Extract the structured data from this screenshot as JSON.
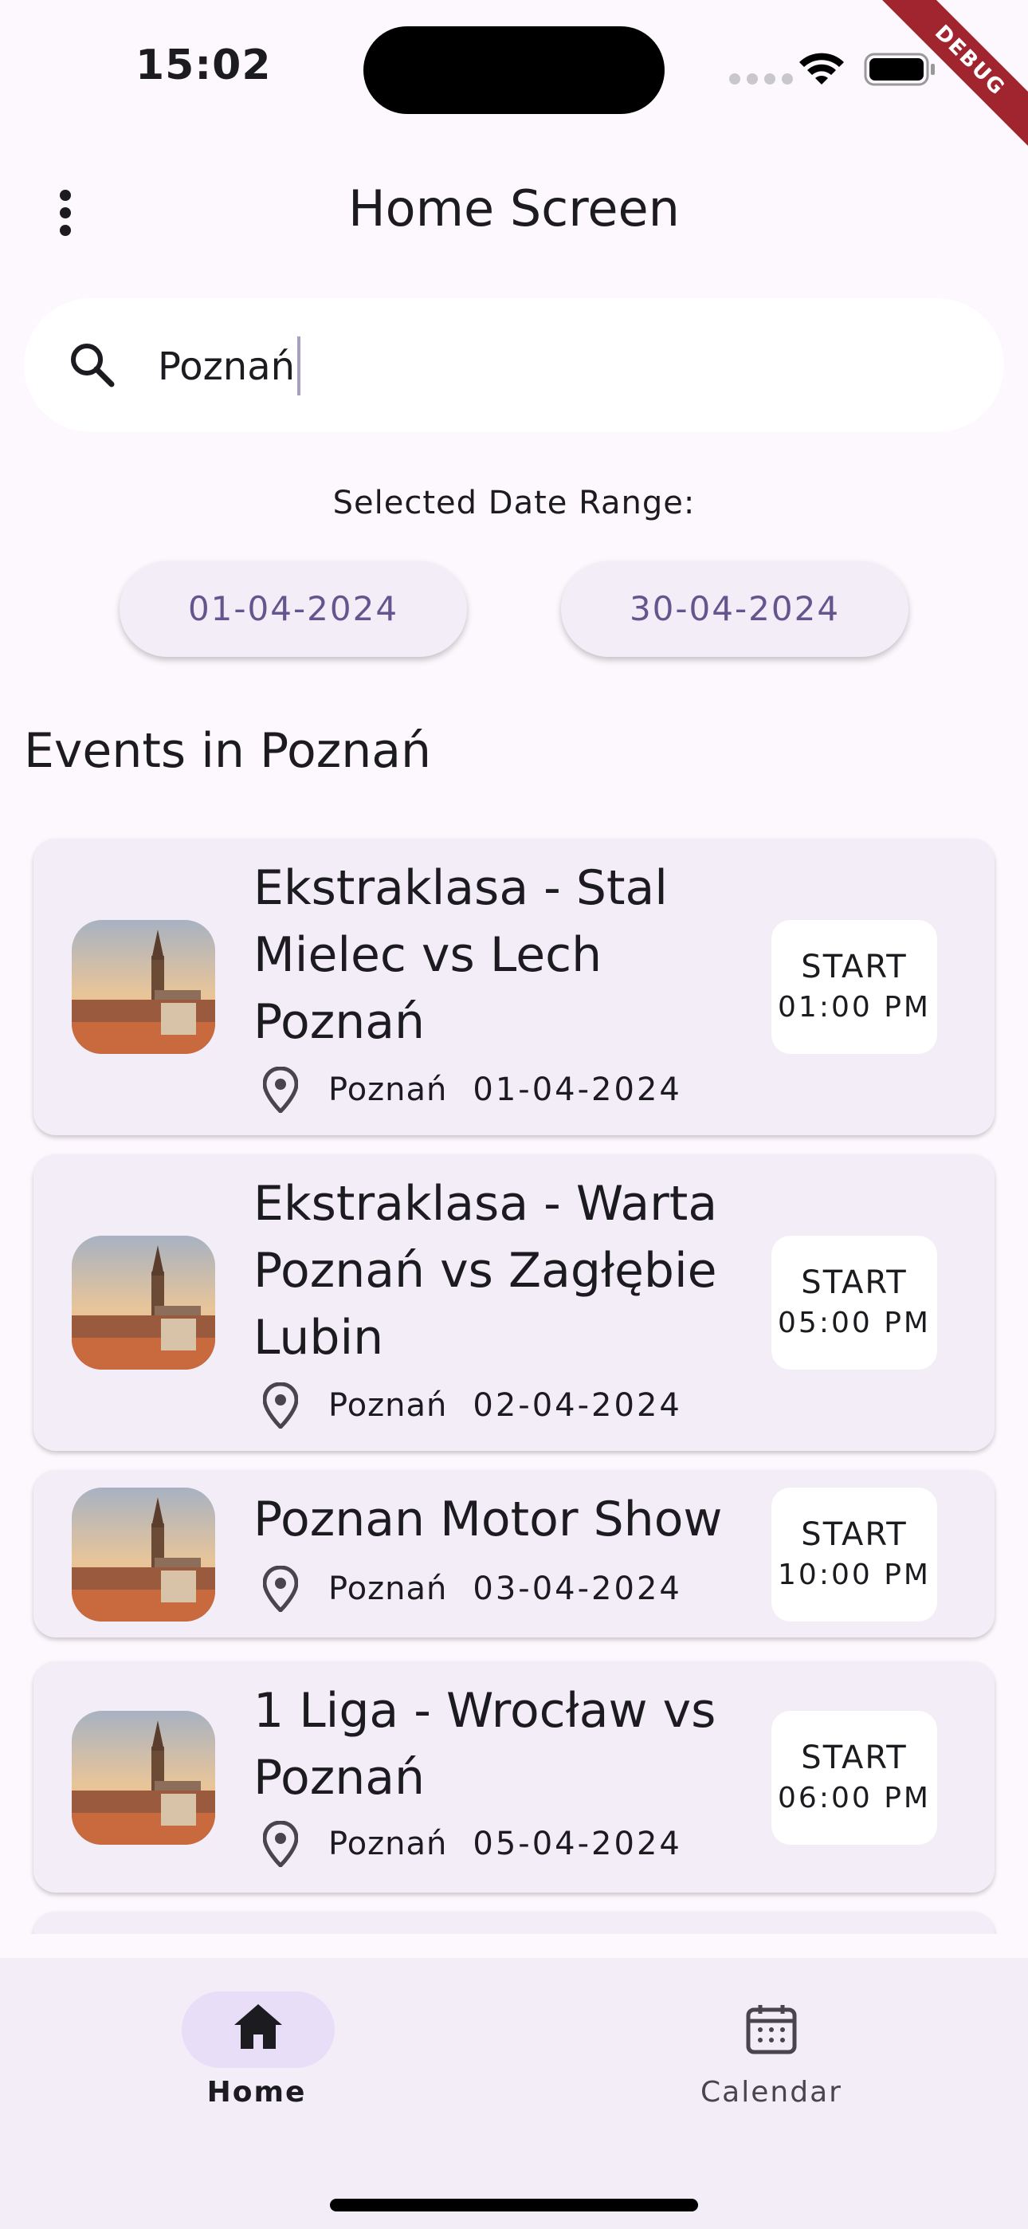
{
  "status_bar": {
    "time": "15:02",
    "debug_label": "DEBUG"
  },
  "app_bar": {
    "title": "Home Screen",
    "menu_icon": "more-vert-icon"
  },
  "search": {
    "value": "Poznań",
    "icon": "search-icon"
  },
  "date_range": {
    "caption": "Selected Date Range:",
    "start": "01-04-2024",
    "end": "30-04-2024"
  },
  "section_title": "Events in Poznań",
  "events": [
    {
      "title_lines": [
        "Ekstraklasa - Stal",
        "Mielec vs Lech",
        "Poznań"
      ],
      "city": "Poznań",
      "date": "01-04-2024",
      "start_label": "START",
      "start_time": "01:00 PM"
    },
    {
      "title_lines": [
        "Ekstraklasa - Warta",
        "Poznań vs Zagłębie",
        "Lubin"
      ],
      "city": "Poznań",
      "date": "02-04-2024",
      "start_label": "START",
      "start_time": "05:00 PM"
    },
    {
      "title_lines": [
        "Poznan Motor Show"
      ],
      "city": "Poznań",
      "date": "03-04-2024",
      "start_label": "START",
      "start_time": "10:00 PM"
    },
    {
      "title_lines": [
        "1 Liga - Wrocław vs",
        "Poznań"
      ],
      "city": "Poznań",
      "date": "05-04-2024",
      "start_label": "START",
      "start_time": "06:00 PM"
    }
  ],
  "bottom_nav": {
    "home_label": "Home",
    "calendar_label": "Calendar"
  },
  "colors": {
    "background": "#fdf7fe",
    "card": "#f3edf7",
    "accent": "#65558f",
    "nav_indicator": "#e8def8"
  }
}
